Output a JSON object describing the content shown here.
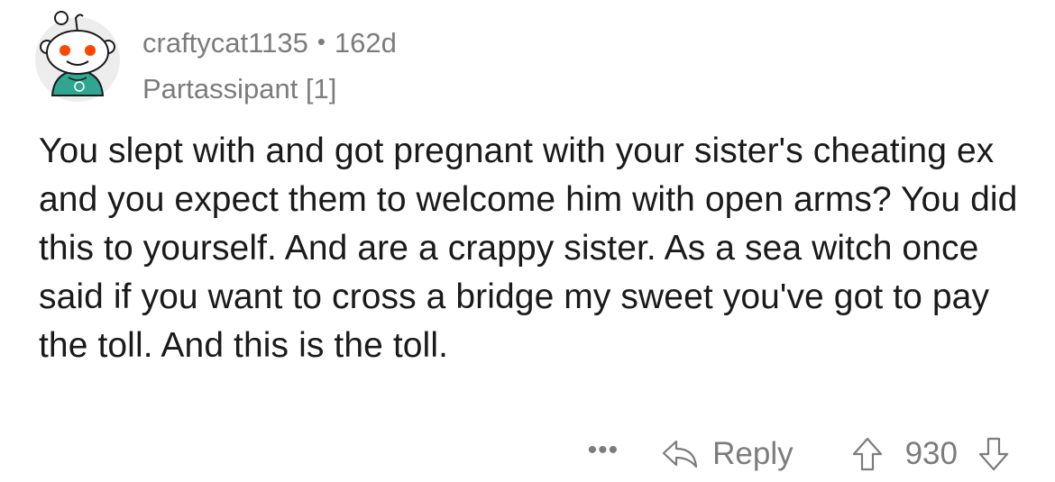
{
  "comment": {
    "author": "craftycat1135",
    "separator": "•",
    "age": "162d",
    "flair": "Partassipant [1]",
    "body": "You slept with and got pregnant with your sister's cheating ex and you expect them to welcome him with open arms? You did this to yourself. And are a crappy sister. As a sea witch once said if you want to cross a bridge my sweet you've got to pay the toll. And this is the toll."
  },
  "actions": {
    "more_label": "•••",
    "reply_label": "Reply",
    "score": "930"
  },
  "icons": {
    "avatar": "reddit-snoo-avatar-icon",
    "reply": "reply-arrow-icon",
    "upvote": "upvote-arrow-icon",
    "downvote": "downvote-arrow-icon"
  },
  "colors": {
    "text": "#1a1a1b",
    "meta": "#7c7c7c",
    "avatar_shirt": "#2fa592"
  }
}
